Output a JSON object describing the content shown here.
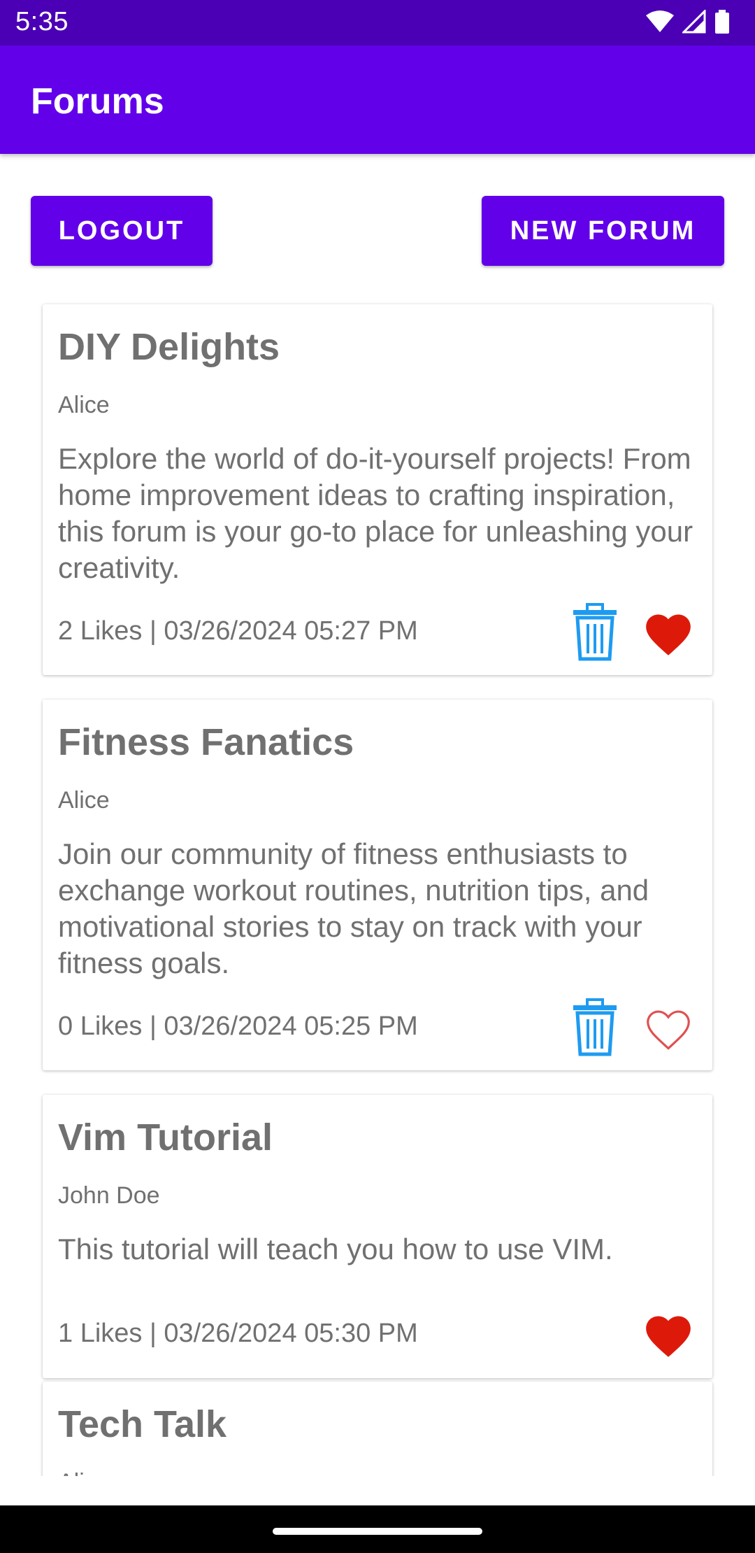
{
  "status_bar": {
    "time": "5:35"
  },
  "app_bar": {
    "title": "Forums"
  },
  "actions": {
    "logout_label": "LOGOUT",
    "new_forum_label": "NEW FORUM"
  },
  "forums": [
    {
      "title": "DIY Delights",
      "author": "Alice",
      "description": "Explore the world of do-it-yourself projects! From home improvement ideas to crafting inspiration, this forum is your go-to place for unleashing your creativity.",
      "meta": "2 Likes | 03/26/2024 05:27 PM",
      "liked": true,
      "deletable": true
    },
    {
      "title": "Fitness Fanatics",
      "author": "Alice",
      "description": "Join our community of fitness enthusiasts to exchange workout routines, nutrition tips, and motivational stories to stay on track with your fitness goals.",
      "meta": "0 Likes | 03/26/2024 05:25 PM",
      "liked": false,
      "deletable": true
    },
    {
      "title": "Vim Tutorial",
      "author": "John Doe",
      "description": "This tutorial will teach you how to use VIM.",
      "meta": "1 Likes | 03/26/2024 05:30 PM",
      "liked": true,
      "deletable": false
    },
    {
      "title": "Tech Talk",
      "author": "Alice"
    }
  ],
  "colors": {
    "primary": "#6200ea",
    "status_bar": "#4b00b5",
    "delete_icon": "#1e9bf0",
    "heart": "#dd1a0a"
  },
  "icons": {
    "delete": "trash-icon",
    "like_filled": "heart-filled-icon",
    "like_outline": "heart-outline-icon"
  }
}
